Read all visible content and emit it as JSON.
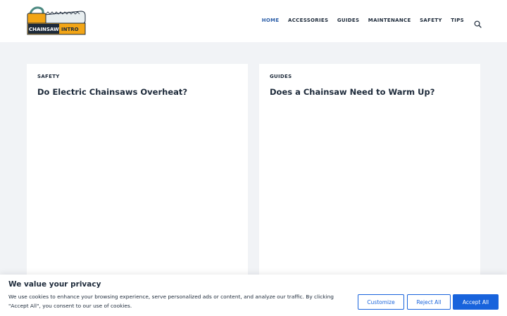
{
  "logo": {
    "line1": "CHAINSAW",
    "line2": "INTRO"
  },
  "nav": {
    "items": [
      {
        "label": "HOME",
        "active": true
      },
      {
        "label": "ACCESSORIES"
      },
      {
        "label": "GUIDES"
      },
      {
        "label": "MAINTENANCE"
      },
      {
        "label": "SAFETY"
      },
      {
        "label": "TIPS"
      }
    ],
    "search_icon": "search-icon"
  },
  "posts": [
    {
      "category": "SAFETY",
      "title": "Do Electric Chainsaws Overheat?"
    },
    {
      "category": "GUIDES",
      "title": "Does a Chainsaw Need to Warm Up?"
    }
  ],
  "cookie": {
    "title": "We value your privacy",
    "text": "We use cookies to enhance your browsing experience, serve personalized ads or content, and analyze our traffic. By clicking \"Accept All\", you consent to our use of cookies.",
    "customize_label": "Customize",
    "reject_label": "Reject All",
    "accept_label": "Accept All"
  },
  "colors": {
    "accent": "#1863dc",
    "nav_active": "#2c5ea8",
    "logo_orange": "#f2a516",
    "logo_teal": "#4d8a82"
  }
}
